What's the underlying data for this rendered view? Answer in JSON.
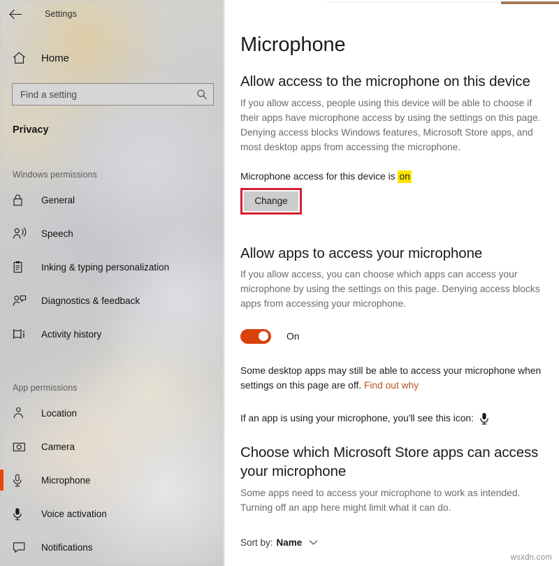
{
  "window": {
    "title": "Settings",
    "back_icon": "back-arrow-icon"
  },
  "sidebar": {
    "home_label": "Home",
    "home_icon": "home-icon",
    "search": {
      "placeholder": "Find a setting",
      "value": "",
      "icon": "search-icon"
    },
    "category": "Privacy",
    "groups": [
      {
        "label": "Windows permissions",
        "items": [
          {
            "label": "General",
            "icon": "lock-icon",
            "selected": false
          },
          {
            "label": "Speech",
            "icon": "person-speaking-icon",
            "selected": false
          },
          {
            "label": "Inking & typing personalization",
            "icon": "clipboard-pen-icon",
            "selected": false
          },
          {
            "label": "Diagnostics & feedback",
            "icon": "person-feedback-icon",
            "selected": false
          },
          {
            "label": "Activity history",
            "icon": "activity-history-icon",
            "selected": false
          }
        ]
      },
      {
        "label": "App permissions",
        "items": [
          {
            "label": "Location",
            "icon": "location-pin-icon",
            "selected": false
          },
          {
            "label": "Camera",
            "icon": "camera-icon",
            "selected": false
          },
          {
            "label": "Microphone",
            "icon": "microphone-icon",
            "selected": true
          },
          {
            "label": "Voice activation",
            "icon": "voice-activation-icon",
            "selected": false
          },
          {
            "label": "Notifications",
            "icon": "notification-bubble-icon",
            "selected": false
          }
        ]
      }
    ]
  },
  "main": {
    "page_title": "Microphone",
    "device_access": {
      "heading": "Allow access to the microphone on this device",
      "description": "If you allow access, people using this device will be able to choose if their apps have microphone access by using the settings on this page. Denying access blocks Windows features, Microsoft Store apps, and most desktop apps from accessing the microphone.",
      "status_prefix": "Microphone access for this device is ",
      "status_value": "on",
      "change_label": "Change"
    },
    "apps_access": {
      "heading": "Allow apps to access your microphone",
      "description": "If you allow access, you can choose which apps can access your microphone by using the settings on this page. Denying access blocks apps from accessing your microphone.",
      "toggle_state": "On",
      "desktop_note_part1": "Some desktop apps may still be able to access your microphone when settings on this page are off. ",
      "desktop_note_link": "Find out why",
      "icon_note": "If an app is using your microphone, you'll see this icon:",
      "icon_note_icon": "microphone-icon"
    },
    "store_apps": {
      "heading": "Choose which Microsoft Store apps can access your microphone",
      "description": "Some apps need to access your microphone to work as intended. Turning off an app here might limit what it can do.",
      "sort_label": "Sort by:",
      "sort_value": "Name",
      "sort_caret_icon": "chevron-down-icon"
    },
    "watermark": "wsxdn.com"
  },
  "colors": {
    "accent": "#d9400b",
    "selection_bar": "#e8470a",
    "annotation_red": "#d32030",
    "highlight_yellow": "#ffe400",
    "link": "#b55723"
  }
}
